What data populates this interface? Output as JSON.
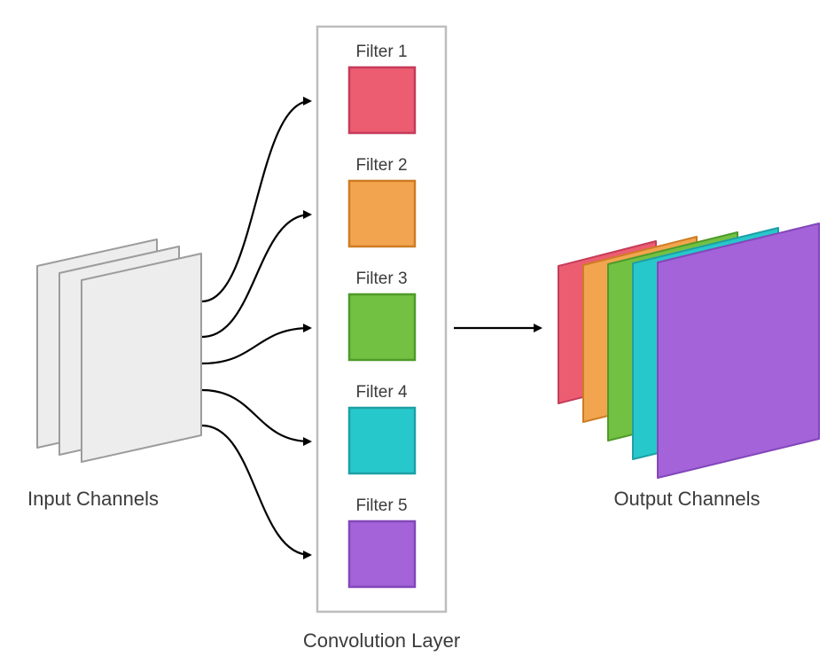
{
  "labels": {
    "input": "Input Channels",
    "layer": "Convolution Layer",
    "output": "Output Channels"
  },
  "filters": [
    {
      "name": "Filter 1",
      "fill": "#EC5D72",
      "stroke": "#C43C59"
    },
    {
      "name": "Filter 2",
      "fill": "#F2A54E",
      "stroke": "#CE7C24"
    },
    {
      "name": "Filter 3",
      "fill": "#73C142",
      "stroke": "#4E9A2A"
    },
    {
      "name": "Filter 4",
      "fill": "#27C8CB",
      "stroke": "#1DA0A5"
    },
    {
      "name": "Filter 5",
      "fill": "#A463D9",
      "stroke": "#8247B9"
    }
  ],
  "input": {
    "planes": 3,
    "fill": "#EDEDED",
    "stroke": "#9C9C9C"
  },
  "output": {
    "planes": 5
  }
}
